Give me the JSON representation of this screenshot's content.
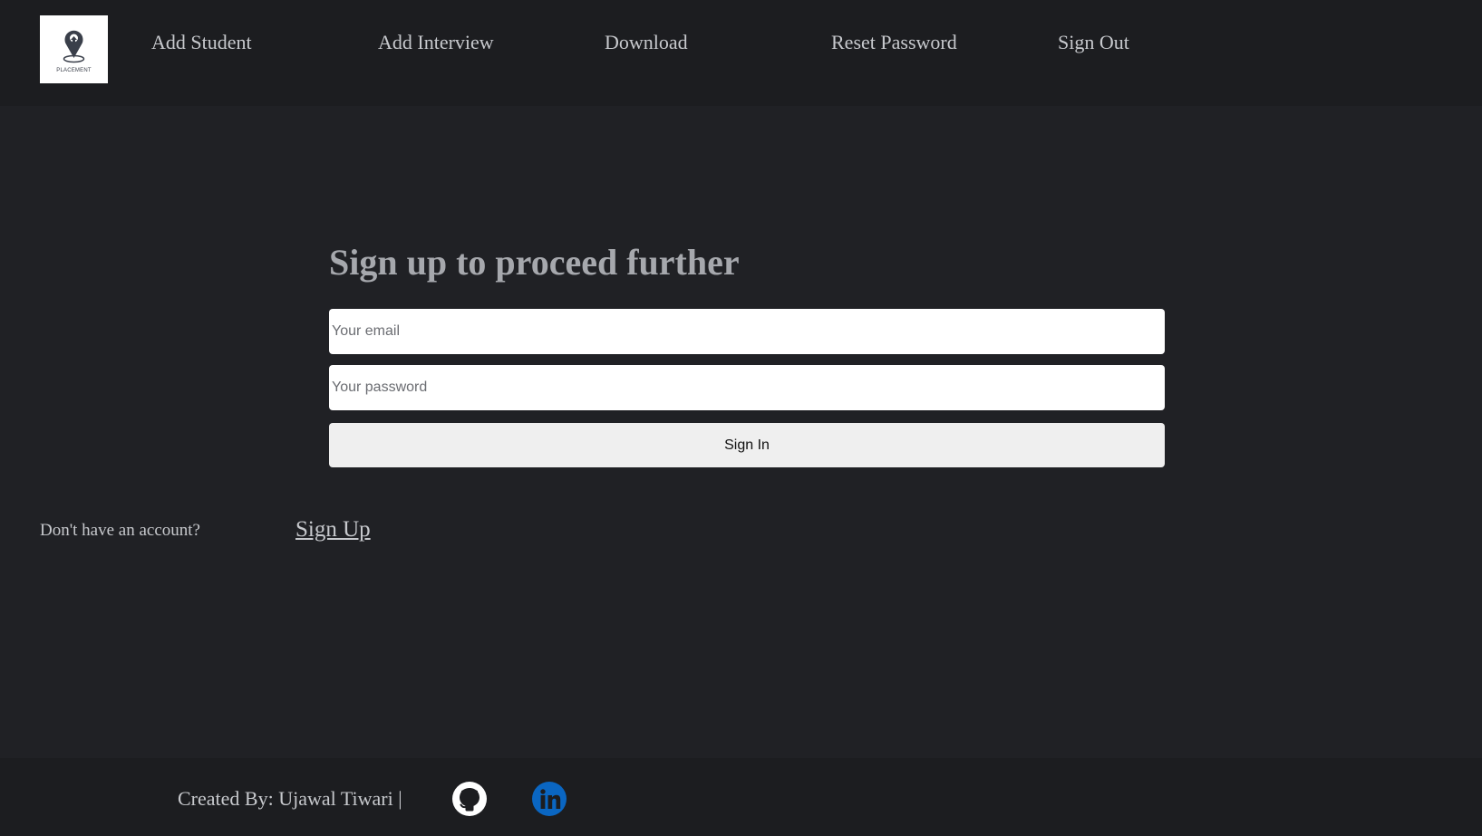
{
  "header": {
    "logo": {
      "text": "PLACEMENT",
      "icon": "placement-logo"
    },
    "nav": [
      {
        "label": "Add Student"
      },
      {
        "label": "Add Interview"
      },
      {
        "label": "Download"
      },
      {
        "label": "Reset Password"
      },
      {
        "label": "Sign Out"
      }
    ]
  },
  "main": {
    "title": "Sign up to proceed further",
    "email_placeholder": "Your email",
    "password_placeholder": "Your password",
    "signin_label": "Sign In",
    "no_account_text": "Don't have an account?",
    "signup_label": "Sign Up"
  },
  "footer": {
    "credit": "Created By: Ujawal Tiwari |",
    "icons": [
      "github-icon",
      "linkedin-icon"
    ],
    "linkedin_color": "#0a66c2"
  }
}
